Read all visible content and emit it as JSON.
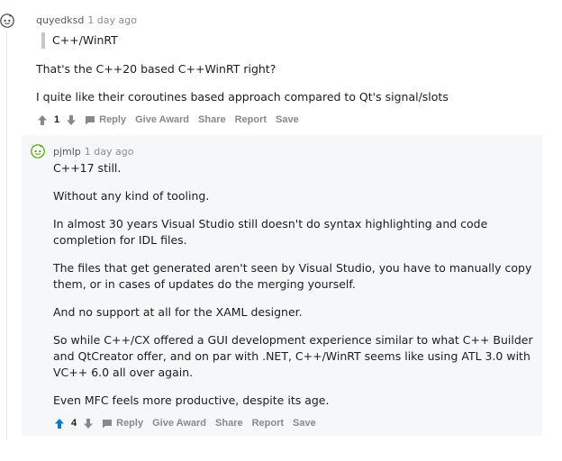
{
  "comment1": {
    "username": "quyedksd",
    "time": "1 day ago",
    "quote": "C++/WinRT",
    "paragraphs": [
      "That's the C++20 based C++WinRT right?",
      "I quite like their coroutines based approach compared to Qt's signal/slots"
    ],
    "score": "1",
    "actions": {
      "reply": "Reply",
      "give_award": "Give Award",
      "share": "Share",
      "report": "Report",
      "save": "Save"
    }
  },
  "comment2": {
    "username": "pjmlp",
    "time": "1 day ago",
    "paragraphs": [
      "C++17 still.",
      "Without any kind of tooling.",
      "In almost 30 years Visual Studio still doesn't do syntax highlighting and code completion for IDL files.",
      "The files that get generated aren't seen by Visual Studio, you have to manually copy them, or in cases of updates do the merging yourself.",
      "And no support at all for the XAML designer.",
      "So while C++/CX offered a GUI development experience similar to what C++ Builder and QtCreator offer, and on par with .NET, C++/WinRT seems like using ATL 3.0 with VC++ 6.0 all over again.",
      "Even MFC feels more productive, despite its age."
    ],
    "score": "4",
    "upvoted": true,
    "actions": {
      "reply": "Reply",
      "give_award": "Give Award",
      "share": "Share",
      "report": "Report",
      "save": "Save"
    }
  },
  "colors": {
    "upvote_active": "#0079d3",
    "meta_text": "#878a8c",
    "reply_background": "#f6f7f8"
  }
}
